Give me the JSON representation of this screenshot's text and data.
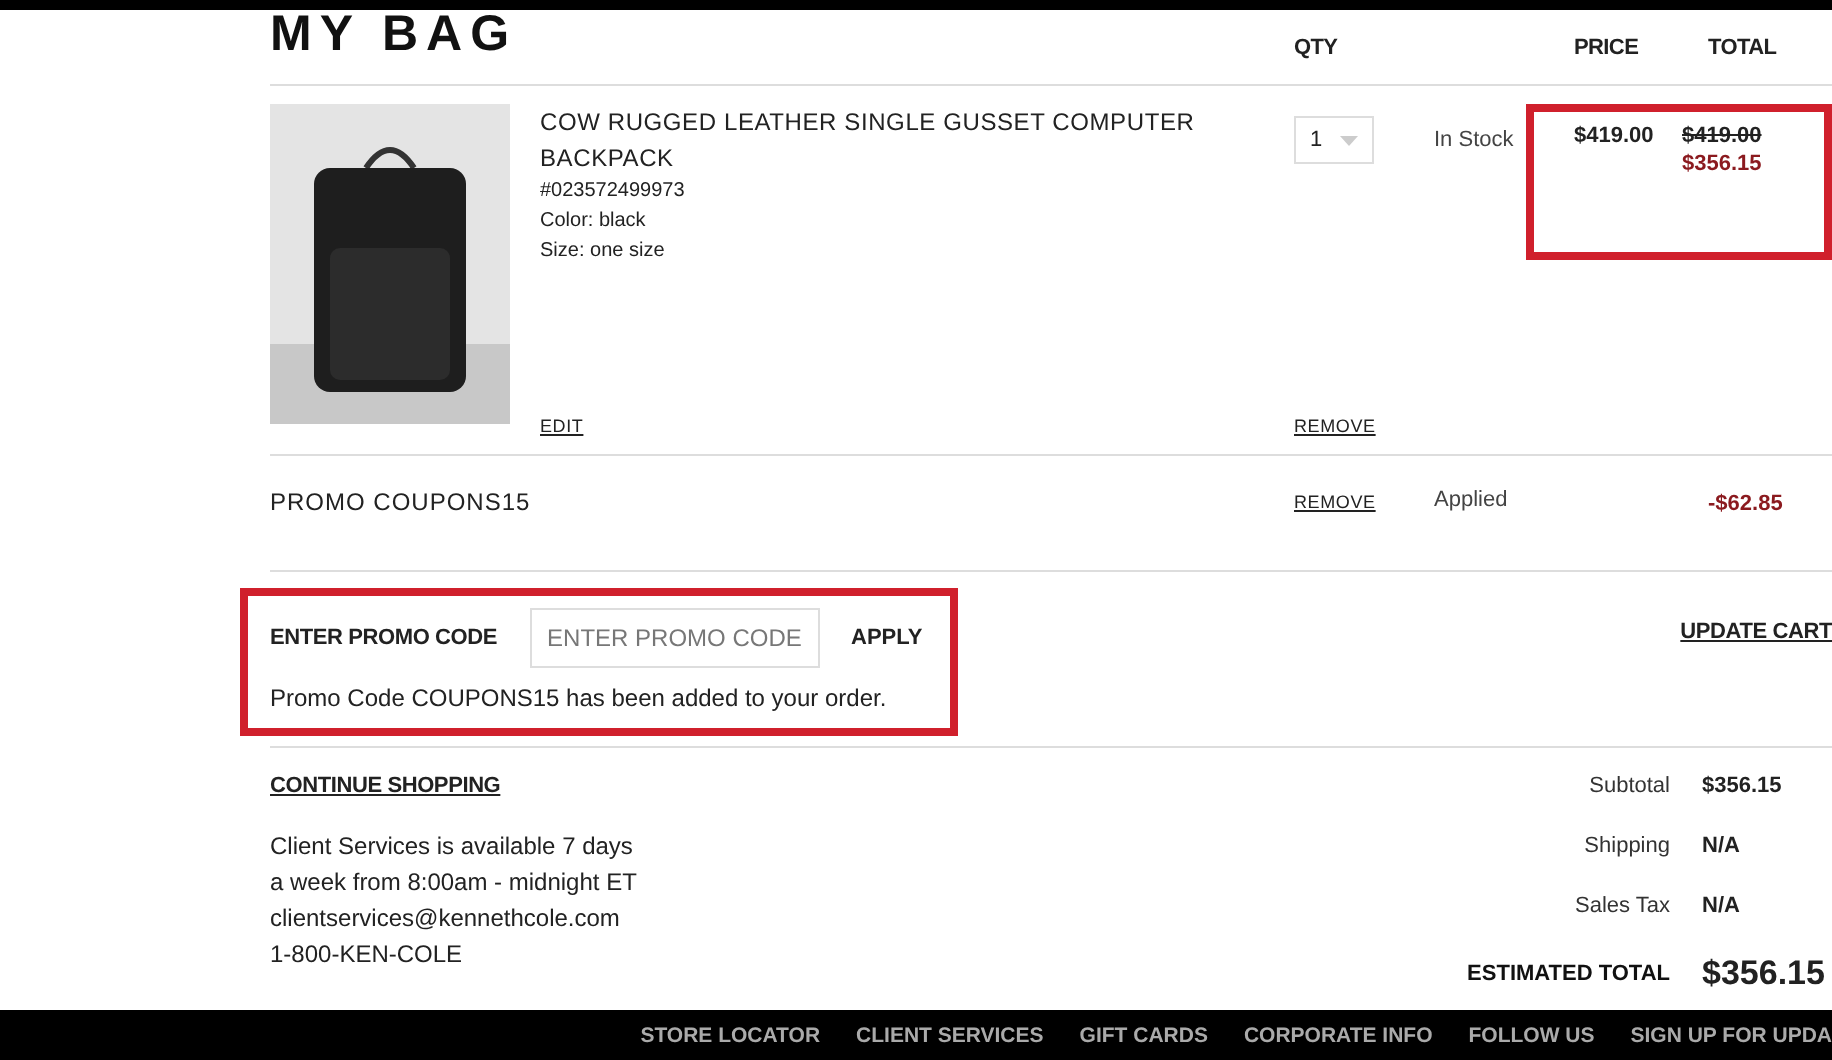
{
  "title": "MY BAG",
  "columns": [
    "QTY",
    "PRICE",
    "TOTAL"
  ],
  "item": {
    "name": "COW RUGGED LEATHER SINGLE GUSSET COMPUTER BACKPACK",
    "sku": "#023572499973",
    "color_line": "Color: black",
    "size": "Size: one size",
    "edit": "EDIT",
    "quantity": "1",
    "remove": "REMOVE",
    "stock": "In Stock",
    "price": "$419.00",
    "original_total": "$419.00",
    "total": "$356.15",
    "highlighted": true
  },
  "promo_line": {
    "label": "PROMO COUPONS15",
    "remove": "REMOVE",
    "status": "Applied",
    "amount": "-$62.85"
  },
  "promo_form": {
    "label": "ENTER PROMO CODE",
    "placeholder": "ENTER PROMO CODE",
    "apply": "APPLY",
    "message": "Promo Code COUPONS15 has been added to your order.",
    "highlighted": true
  },
  "update_cart": "UPDATE CART",
  "continue_shopping": "CONTINUE SHOPPING",
  "service_lines": [
    "Client Services is available 7 days",
    "a week from 8:00am - midnight ET",
    "clientservices@kennethcole.com",
    "1-800-KEN-COLE"
  ],
  "summary": [
    {
      "label": "Subtotal",
      "value": "$356.15",
      "kind": "line"
    },
    {
      "label": "Shipping",
      "value": "N/A",
      "kind": "line"
    },
    {
      "label": "Sales Tax",
      "value": "N/A",
      "kind": "line"
    },
    {
      "label": "ESTIMATED TOTAL",
      "value": "$356.15",
      "kind": "total"
    }
  ],
  "footer_links": [
    "STORE LOCATOR",
    "CLIENT SERVICES",
    "GIFT CARDS",
    "CORPORATE INFO",
    "FOLLOW US",
    "SIGN UP FOR UPDA"
  ]
}
